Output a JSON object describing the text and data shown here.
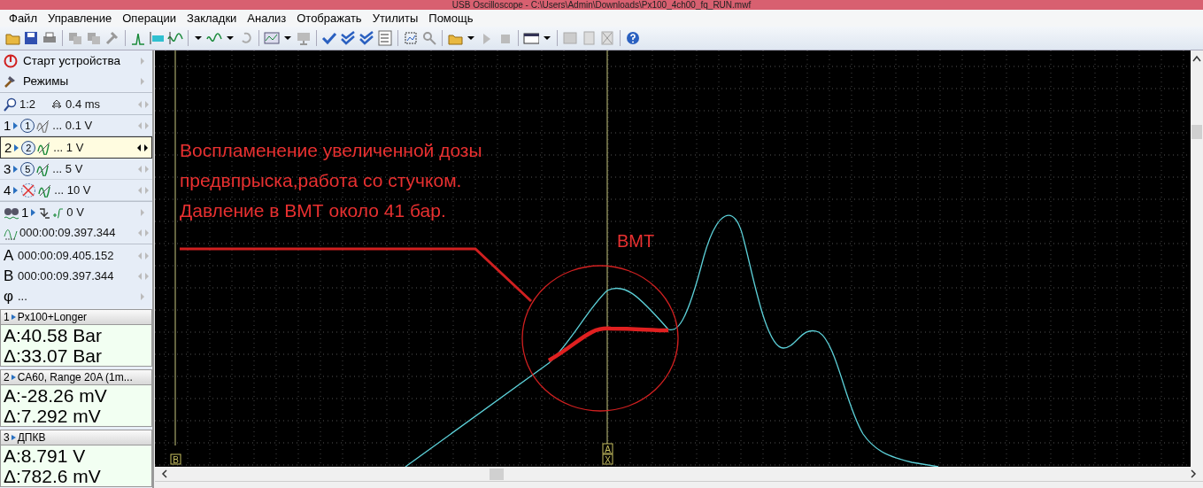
{
  "window": {
    "title": "USB Oscilloscope - C:\\Users\\Admin\\Downloads\\Px100_4ch00_fq_RUN.mwf"
  },
  "menu": [
    "Файл",
    "Управление",
    "Операции",
    "Закладки",
    "Анализ",
    "Отображать",
    "Утилиты",
    "Помощь"
  ],
  "side_panel": {
    "actions": [
      {
        "label": "Старт устройства",
        "kind": "power"
      },
      {
        "label": "Режимы",
        "kind": "modes"
      }
    ],
    "zoom": {
      "ratio": "1:2",
      "timebase": "0.4 ms"
    },
    "channels": [
      {
        "number": "1",
        "badge": "1",
        "enabled": true,
        "scale": "... 0.1 V",
        "selected": false
      },
      {
        "number": "2",
        "badge": "2",
        "enabled": true,
        "scale": "... 1 V",
        "selected": true
      },
      {
        "number": "3",
        "badge": "5",
        "enabled": true,
        "scale": "... 5 V",
        "selected": false
      },
      {
        "number": "4",
        "enabled": false,
        "scale": "... 10 V",
        "selected": false
      }
    ],
    "trigger": {
      "channel": "1",
      "threshold": "0 V"
    },
    "trigger_time": "000:00:09.397.344",
    "cursors": [
      {
        "label": "A",
        "time": "000:00:09.405.152"
      },
      {
        "label": "B",
        "time": "000:00:09.397.344"
      },
      {
        "label": "φ",
        "time": "..."
      }
    ],
    "measurements": [
      {
        "channel": "1",
        "name": "Px100+Longer",
        "lines": [
          "A:40.58 Bar",
          "Δ:33.07 Bar"
        ]
      },
      {
        "channel": "2",
        "name": "CA60, Range 20A (1m...",
        "lines": [
          "A:-28.26 mV",
          "Δ:7.292 mV"
        ]
      },
      {
        "channel": "3",
        "name": "ДПКВ",
        "lines": [
          "A:8.791 V",
          "Δ:782.6 mV"
        ]
      }
    ]
  },
  "plot": {
    "annotation": [
      "Воспламенение увеличенной дозы",
      "предвпрыска,работа со стучком.",
      "Давление в ВМТ около 41 бар."
    ],
    "marker_label": "ВМТ",
    "cursor_markers": [
      {
        "labels": [
          "B"
        ]
      },
      {
        "labels": [
          "A",
          "X"
        ]
      }
    ]
  }
}
